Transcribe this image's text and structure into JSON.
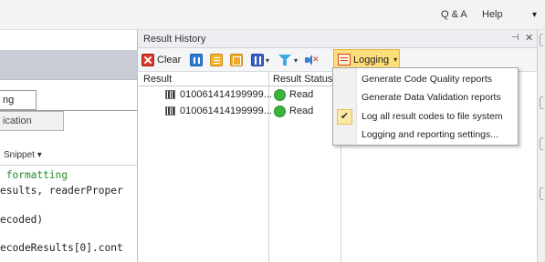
{
  "topbar": {
    "qa_label": "Q & A",
    "help_label": "Help",
    "caret": "▾"
  },
  "left_panel": {
    "tab_active": "ng",
    "tab_inactive": "ication",
    "snippet_label": "Snippet ▾",
    "code_lines": [
      {
        "text": " formatting",
        "color": "#2a8a2a"
      },
      {
        "text": "esults, readerProper",
        "color": "#1e1e1e"
      },
      {
        "text": "ecoded)",
        "color": "#1e1e1e"
      },
      {
        "text": "ecodeResults[0].cont",
        "color": "#1e1e1e"
      }
    ]
  },
  "result_history": {
    "title": "Result History",
    "pin_icon": "pin-icon",
    "close_icon": "close-icon",
    "toolbar": {
      "clear_label": "Clear",
      "logging_label": "Logging",
      "caret": "▾"
    },
    "columns": [
      "Result",
      "Result Status"
    ],
    "rows": [
      {
        "result": "010061414199999...",
        "status": "Read"
      },
      {
        "result": "010061414199999...",
        "status": "Read"
      }
    ]
  },
  "logging_menu": {
    "items": [
      {
        "label": "Generate Code Quality reports",
        "checked": false
      },
      {
        "label": "Generate Data Validation reports",
        "checked": false
      },
      {
        "label": "Log all result codes to file system",
        "checked": true
      },
      {
        "label": "Logging and reporting settings...",
        "checked": false
      }
    ]
  },
  "colors": {
    "status_ok": "#3cb43c",
    "logging_highlight": "#fdde7a",
    "clear_red": "#d9392b"
  }
}
